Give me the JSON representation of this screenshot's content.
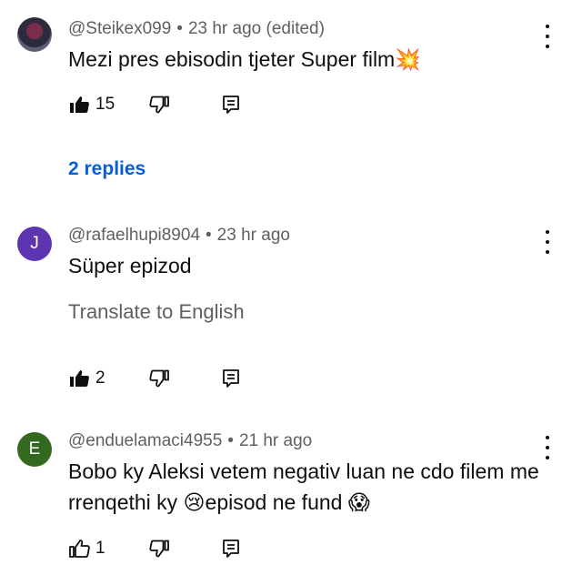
{
  "comments": [
    {
      "avatar_type": "photo",
      "handle": "@Steikex099",
      "separator": "•",
      "time": "23 hr ago (edited)",
      "text": "Mezi pres ebisodin tjeter Super film💥",
      "likes": "15",
      "liked": true,
      "replies_label": "2 replies"
    },
    {
      "avatar_letter": "J",
      "avatar_color": "#5e35b1",
      "handle": "@rafaelhupi8904",
      "separator": "•",
      "time": "23 hr ago",
      "text": "Süper epizod",
      "translate_label": "Translate to English",
      "likes": "2",
      "liked": true
    },
    {
      "avatar_letter": "E",
      "avatar_color": "#33691e",
      "handle": "@enduelamaci4955",
      "separator": "•",
      "time": "21 hr ago",
      "text": "Bobo ky Aleksi vetem negativ luan ne cdo filem me rrenqethi ky 😢episod ne fund 😱",
      "likes": "1",
      "liked": false
    }
  ],
  "icons": {
    "like": "thumbs-up-icon",
    "dislike": "thumbs-down-icon",
    "reply": "reply-comment-icon",
    "more": "more-vertical-icon"
  },
  "colors": {
    "link": "#065fd4",
    "secondary_text": "#606060"
  }
}
